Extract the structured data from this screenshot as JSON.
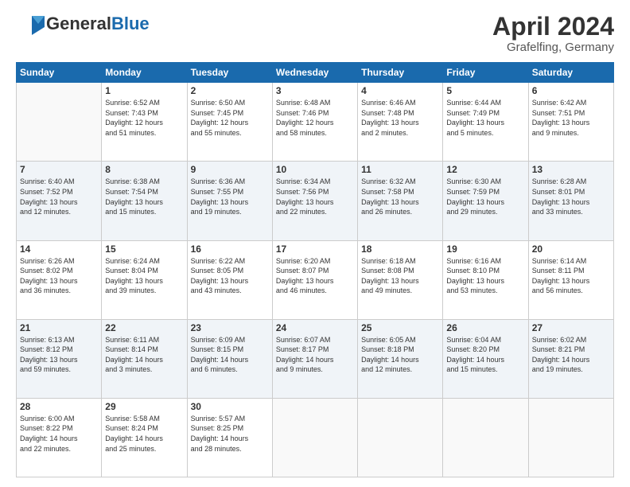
{
  "header": {
    "logo_general": "General",
    "logo_blue": "Blue",
    "month_title": "April 2024",
    "location": "Grafelfing, Germany"
  },
  "weekdays": [
    "Sunday",
    "Monday",
    "Tuesday",
    "Wednesday",
    "Thursday",
    "Friday",
    "Saturday"
  ],
  "weeks": [
    [
      {
        "day": "",
        "info": ""
      },
      {
        "day": "1",
        "info": "Sunrise: 6:52 AM\nSunset: 7:43 PM\nDaylight: 12 hours\nand 51 minutes."
      },
      {
        "day": "2",
        "info": "Sunrise: 6:50 AM\nSunset: 7:45 PM\nDaylight: 12 hours\nand 55 minutes."
      },
      {
        "day": "3",
        "info": "Sunrise: 6:48 AM\nSunset: 7:46 PM\nDaylight: 12 hours\nand 58 minutes."
      },
      {
        "day": "4",
        "info": "Sunrise: 6:46 AM\nSunset: 7:48 PM\nDaylight: 13 hours\nand 2 minutes."
      },
      {
        "day": "5",
        "info": "Sunrise: 6:44 AM\nSunset: 7:49 PM\nDaylight: 13 hours\nand 5 minutes."
      },
      {
        "day": "6",
        "info": "Sunrise: 6:42 AM\nSunset: 7:51 PM\nDaylight: 13 hours\nand 9 minutes."
      }
    ],
    [
      {
        "day": "7",
        "info": "Sunrise: 6:40 AM\nSunset: 7:52 PM\nDaylight: 13 hours\nand 12 minutes."
      },
      {
        "day": "8",
        "info": "Sunrise: 6:38 AM\nSunset: 7:54 PM\nDaylight: 13 hours\nand 15 minutes."
      },
      {
        "day": "9",
        "info": "Sunrise: 6:36 AM\nSunset: 7:55 PM\nDaylight: 13 hours\nand 19 minutes."
      },
      {
        "day": "10",
        "info": "Sunrise: 6:34 AM\nSunset: 7:56 PM\nDaylight: 13 hours\nand 22 minutes."
      },
      {
        "day": "11",
        "info": "Sunrise: 6:32 AM\nSunset: 7:58 PM\nDaylight: 13 hours\nand 26 minutes."
      },
      {
        "day": "12",
        "info": "Sunrise: 6:30 AM\nSunset: 7:59 PM\nDaylight: 13 hours\nand 29 minutes."
      },
      {
        "day": "13",
        "info": "Sunrise: 6:28 AM\nSunset: 8:01 PM\nDaylight: 13 hours\nand 33 minutes."
      }
    ],
    [
      {
        "day": "14",
        "info": "Sunrise: 6:26 AM\nSunset: 8:02 PM\nDaylight: 13 hours\nand 36 minutes."
      },
      {
        "day": "15",
        "info": "Sunrise: 6:24 AM\nSunset: 8:04 PM\nDaylight: 13 hours\nand 39 minutes."
      },
      {
        "day": "16",
        "info": "Sunrise: 6:22 AM\nSunset: 8:05 PM\nDaylight: 13 hours\nand 43 minutes."
      },
      {
        "day": "17",
        "info": "Sunrise: 6:20 AM\nSunset: 8:07 PM\nDaylight: 13 hours\nand 46 minutes."
      },
      {
        "day": "18",
        "info": "Sunrise: 6:18 AM\nSunset: 8:08 PM\nDaylight: 13 hours\nand 49 minutes."
      },
      {
        "day": "19",
        "info": "Sunrise: 6:16 AM\nSunset: 8:10 PM\nDaylight: 13 hours\nand 53 minutes."
      },
      {
        "day": "20",
        "info": "Sunrise: 6:14 AM\nSunset: 8:11 PM\nDaylight: 13 hours\nand 56 minutes."
      }
    ],
    [
      {
        "day": "21",
        "info": "Sunrise: 6:13 AM\nSunset: 8:12 PM\nDaylight: 13 hours\nand 59 minutes."
      },
      {
        "day": "22",
        "info": "Sunrise: 6:11 AM\nSunset: 8:14 PM\nDaylight: 14 hours\nand 3 minutes."
      },
      {
        "day": "23",
        "info": "Sunrise: 6:09 AM\nSunset: 8:15 PM\nDaylight: 14 hours\nand 6 minutes."
      },
      {
        "day": "24",
        "info": "Sunrise: 6:07 AM\nSunset: 8:17 PM\nDaylight: 14 hours\nand 9 minutes."
      },
      {
        "day": "25",
        "info": "Sunrise: 6:05 AM\nSunset: 8:18 PM\nDaylight: 14 hours\nand 12 minutes."
      },
      {
        "day": "26",
        "info": "Sunrise: 6:04 AM\nSunset: 8:20 PM\nDaylight: 14 hours\nand 15 minutes."
      },
      {
        "day": "27",
        "info": "Sunrise: 6:02 AM\nSunset: 8:21 PM\nDaylight: 14 hours\nand 19 minutes."
      }
    ],
    [
      {
        "day": "28",
        "info": "Sunrise: 6:00 AM\nSunset: 8:22 PM\nDaylight: 14 hours\nand 22 minutes."
      },
      {
        "day": "29",
        "info": "Sunrise: 5:58 AM\nSunset: 8:24 PM\nDaylight: 14 hours\nand 25 minutes."
      },
      {
        "day": "30",
        "info": "Sunrise: 5:57 AM\nSunset: 8:25 PM\nDaylight: 14 hours\nand 28 minutes."
      },
      {
        "day": "",
        "info": ""
      },
      {
        "day": "",
        "info": ""
      },
      {
        "day": "",
        "info": ""
      },
      {
        "day": "",
        "info": ""
      }
    ]
  ]
}
